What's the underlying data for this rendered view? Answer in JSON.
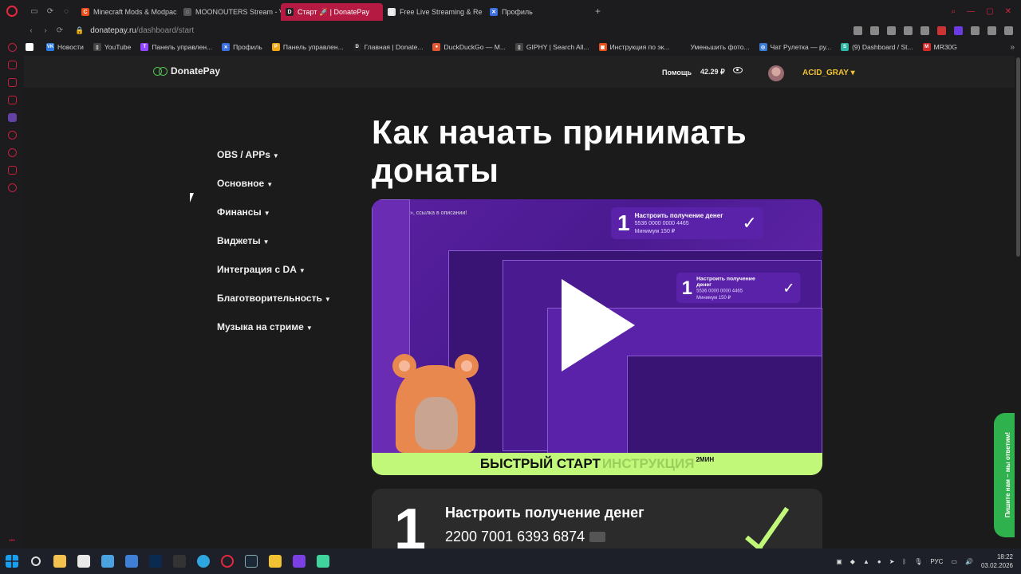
{
  "browser": {
    "tabs": [
      {
        "label": "Minecraft Mods & Modpac",
        "fav_color": "#e94e1b",
        "fav_glyph": "C",
        "active": false
      },
      {
        "label": "MOONOUTERS Stream - V",
        "fav_color": "#555555",
        "fav_glyph": "◌",
        "active": false
      },
      {
        "label": "Старт 🚀 | DonatePay",
        "fav_color": "#222222",
        "fav_glyph": "D",
        "active": true
      },
      {
        "label": "Free Live Streaming & Re",
        "fav_color": "#e5e5e5",
        "fav_glyph": "▯",
        "active": false
      },
      {
        "label": "Профиль",
        "fav_color": "#3c6fe0",
        "fav_glyph": "✕",
        "active": false
      }
    ],
    "url_host": "donatepay.ru",
    "url_path": "/dashboard/start",
    "bookmarks": [
      {
        "label": "",
        "fav_color": "#ffffff",
        "fav_glyph": "Ⓒ"
      },
      {
        "label": "Новости",
        "fav_color": "#2d7be5",
        "fav_glyph": "VK"
      },
      {
        "label": "YouTube",
        "fav_color": "#444444",
        "fav_glyph": "▯"
      },
      {
        "label": "Панель управлен...",
        "fav_color": "#9146ff",
        "fav_glyph": "T"
      },
      {
        "label": "Профиль",
        "fav_color": "#3c6fe0",
        "fav_glyph": "✕"
      },
      {
        "label": "Панель управлен...",
        "fav_color": "#f3a712",
        "fav_glyph": "P"
      },
      {
        "label": "Главная | Donate...",
        "fav_color": "#222222",
        "fav_glyph": "D"
      },
      {
        "label": "DuckDuckGo — M...",
        "fav_color": "#de5833",
        "fav_glyph": "●"
      },
      {
        "label": "GIPHY | Search All...",
        "fav_color": "#444444",
        "fav_glyph": "▯"
      },
      {
        "label": "Инструкция по эк...",
        "fav_color": "#e94e1b",
        "fav_glyph": "▣"
      },
      {
        "label": "Уменьшить фото...",
        "fav_color": "#1c1c1f",
        "fav_glyph": ""
      },
      {
        "label": "Чат Рулетка — ру...",
        "fav_color": "#3a7bd5",
        "fav_glyph": "◎"
      },
      {
        "label": "(9) Dashboard / St...",
        "fav_color": "#2fb7a4",
        "fav_glyph": "S"
      },
      {
        "label": "MR30G",
        "fav_color": "#d42a2a",
        "fav_glyph": "M"
      }
    ]
  },
  "site": {
    "brand": "DonatePay",
    "help_label": "Помощь",
    "balance": "42.29 ₽",
    "username": "ACID_GRAY",
    "heading": "Как начать принимать донаты",
    "menu": [
      {
        "label": "OBS / APPs"
      },
      {
        "label": "Основное"
      },
      {
        "label": "Финансы"
      },
      {
        "label": "Виджеты"
      },
      {
        "label": "Интеграция с DA"
      },
      {
        "label": "Благотворительность"
      },
      {
        "label": "Музыка на стриме"
      }
    ],
    "video": {
      "caption": "», ссылка в описании!",
      "mini_num": "1",
      "mini_title": "Настроить получение денег",
      "mini_card": "5536 0000 0000 4465",
      "mini_min": "Минимум 150 ₽",
      "footer_strong": "БЫСТРЫЙ СТАРТ",
      "footer_light": "ИНСТРУКЦИЯ",
      "footer_time": "2МИН"
    },
    "step": {
      "number": "1",
      "title": "Настроить получение денег",
      "card_number": "2200 7001 6393 6874"
    },
    "feedback": "Пишите нам – мы ответим!"
  },
  "taskbar": {
    "lang": "РУС",
    "time": "18:22",
    "date": "03.02.2026"
  }
}
